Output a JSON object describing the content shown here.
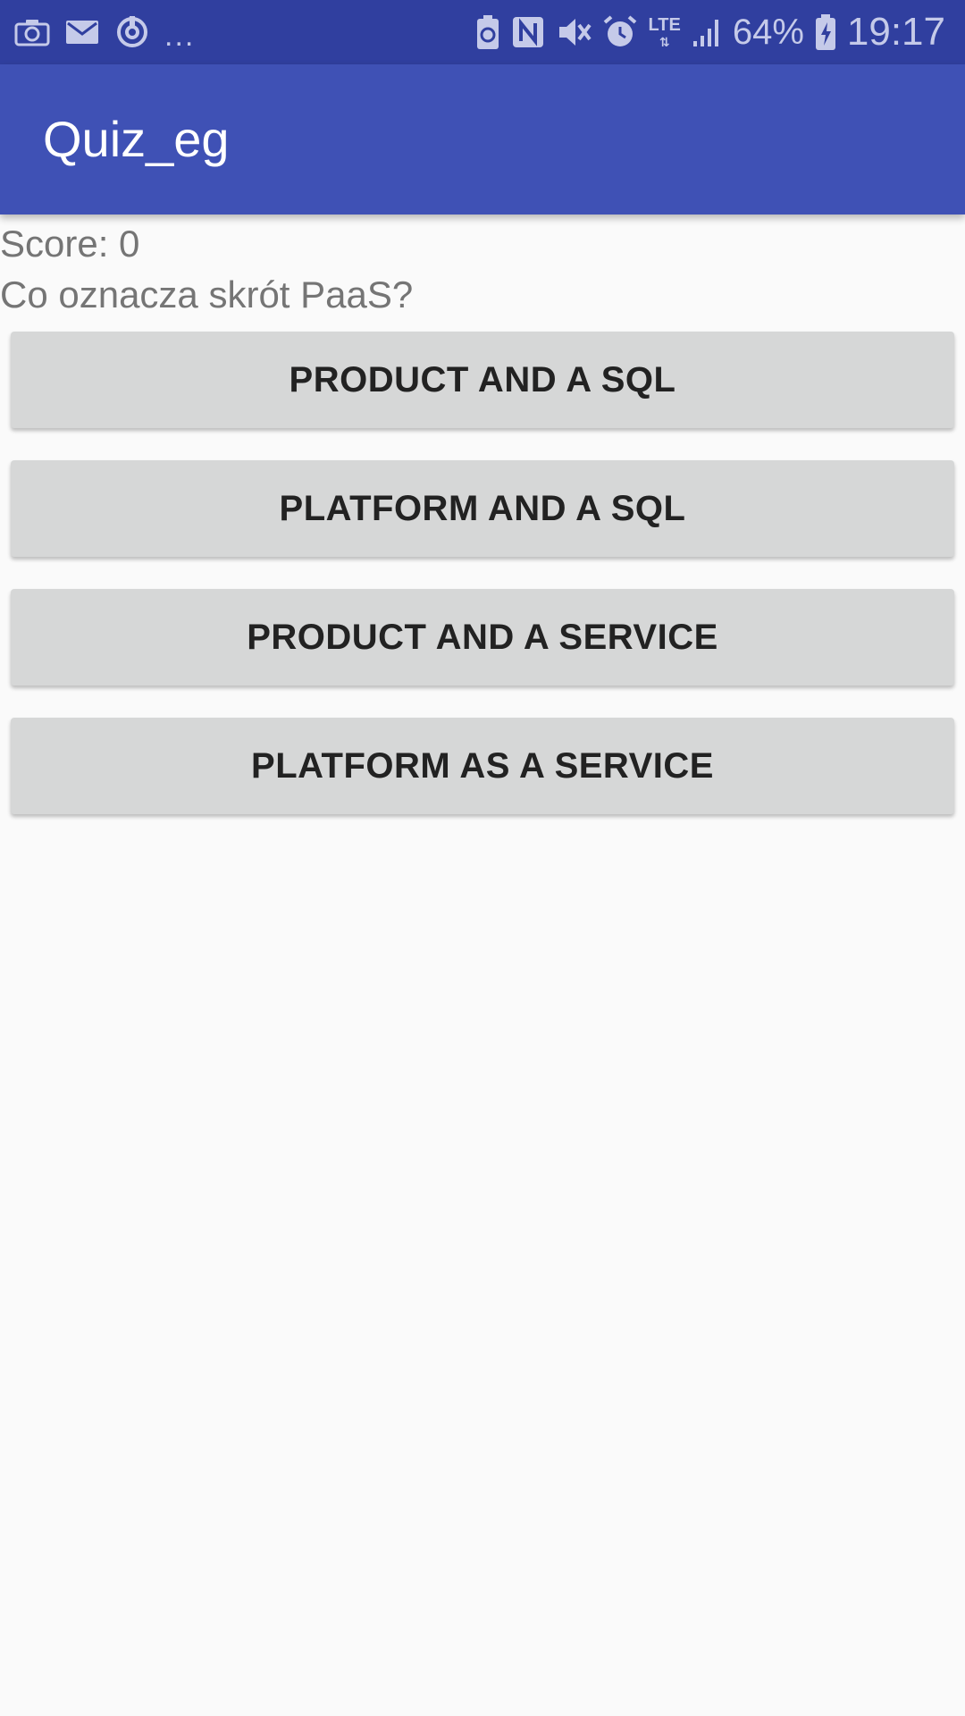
{
  "status_bar": {
    "left_icons": [
      "camera-icon",
      "mail-icon",
      "sync-icon"
    ],
    "overflow": "...",
    "right_icons": [
      "battery-saver-icon",
      "nfc-icon",
      "vibrate-icon",
      "alarm-icon"
    ],
    "network_type": "LTE",
    "signal_icon": "signal-bars-icon",
    "battery_percent": "64%",
    "battery_icon": "battery-charging-icon",
    "time": "19:17",
    "background_color": "#303f9f"
  },
  "app_bar": {
    "title": "Quiz_eg",
    "background_color": "#3f51b5"
  },
  "quiz": {
    "score_label": "Score: 0",
    "question": "Co oznacza skrót PaaS?",
    "answers": [
      {
        "label": "PRODUCT AND A SQL"
      },
      {
        "label": "PLATFORM AND A SQL"
      },
      {
        "label": "PRODUCT AND A SERVICE"
      },
      {
        "label": "PLATFORM AS A SERVICE"
      }
    ]
  }
}
